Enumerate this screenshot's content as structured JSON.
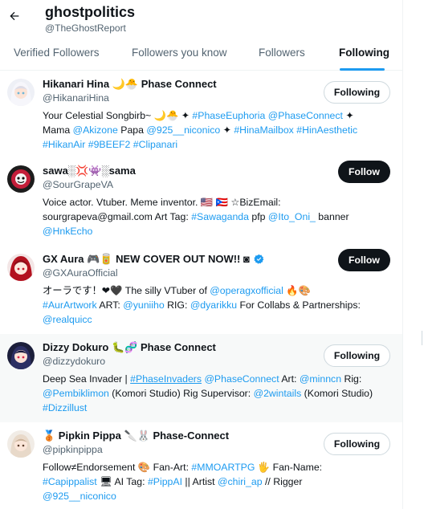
{
  "header": {
    "title": "ghostpolitics",
    "handle": "@TheGhostReport"
  },
  "tabs": [
    {
      "label": "Verified Followers"
    },
    {
      "label": "Followers you know"
    },
    {
      "label": "Followers"
    },
    {
      "label": "Following"
    }
  ],
  "active_tab": "Following",
  "users": [
    {
      "name": "Hikanari Hina",
      "name_suffix": " Phase Connect",
      "handle": "@HikanariHina",
      "button": "Following",
      "bio_lines": [
        [
          {
            "t": "Your Celestial Songbirb~ 🌙🐣 ✦ "
          },
          {
            "t": "#PhaseEuphoria",
            "k": "link"
          },
          {
            "t": " "
          },
          {
            "t": "@PhaseConnect",
            "k": "link"
          },
          {
            "t": " ✦"
          }
        ],
        [
          {
            "t": "Mama "
          },
          {
            "t": "@Akizone",
            "k": "link"
          },
          {
            "t": " Papa "
          },
          {
            "t": "@925__niconico",
            "k": "link"
          },
          {
            "t": " ✦ "
          },
          {
            "t": "#HinaMailbox",
            "k": "link"
          },
          {
            "t": " "
          },
          {
            "t": "#HinAesthetic",
            "k": "link"
          }
        ],
        [
          {
            "t": "#HikanAir",
            "k": "link"
          },
          {
            "t": " "
          },
          {
            "t": "#9BEEF2",
            "k": "link"
          },
          {
            "t": " "
          },
          {
            "t": "#Clipanari",
            "k": "link"
          }
        ]
      ]
    },
    {
      "name": "sawa░💢👾░sama",
      "name_suffix": "",
      "handle": "@SourGrapeVA",
      "button": "Follow",
      "bio_lines": [
        [
          {
            "t": "Voice actor. Vtuber. Meme inventor. 🇺🇸 🇵🇷 ☆BizEmail:"
          }
        ],
        [
          {
            "t": "sourgrapeva@gmail.com Art Tag: "
          },
          {
            "t": "#Sawaganda",
            "k": "link"
          },
          {
            "t": " pfp "
          },
          {
            "t": "@Ito_Oni_",
            "k": "link"
          },
          {
            "t": " banner"
          }
        ],
        [
          {
            "t": "@HnkEcho",
            "k": "link"
          }
        ]
      ]
    },
    {
      "name": "GX Aura 🎮🥫 NEW COVER OUT NOW!! ◙",
      "name_suffix": "",
      "handle": "@GXAuraOfficial",
      "button": "Follow",
      "verified": true,
      "bio_lines": [
        [
          {
            "t": "オーラです！❤🖤 The silly VTuber of "
          },
          {
            "t": "@operagxofficial",
            "k": "link"
          },
          {
            "t": " 🔥🎨"
          }
        ],
        [
          {
            "t": "#AurArtwork",
            "k": "link"
          },
          {
            "t": " ART: "
          },
          {
            "t": "@yuniiho",
            "k": "link"
          },
          {
            "t": " RIG: "
          },
          {
            "t": "@dyarikku",
            "k": "link"
          },
          {
            "t": " For Collabs & Partnerships:"
          }
        ],
        [
          {
            "t": "@realquicc",
            "k": "link"
          }
        ]
      ]
    },
    {
      "name": "Dizzy Dokuro",
      "name_suffix": " Phase Connect",
      "handle": "@dizzydokuro",
      "button": "Following",
      "bio_lines": [
        [
          {
            "t": "Deep Sea Invader | "
          },
          {
            "t": "#PhaseInvaders",
            "k": "under"
          },
          {
            "t": " "
          },
          {
            "t": "@PhaseConnect",
            "k": "link"
          },
          {
            "t": " Art: "
          },
          {
            "t": "@minncn",
            "k": "link"
          },
          {
            "t": " Rig:"
          }
        ],
        [
          {
            "t": "@Pembiklimon",
            "k": "link"
          },
          {
            "t": " (Komori Studio) Rig Supervisor: "
          },
          {
            "t": "@2wintails",
            "k": "link"
          },
          {
            "t": " (Komori Studio)"
          }
        ],
        [
          {
            "t": "#Dizzillust",
            "k": "link"
          }
        ]
      ]
    },
    {
      "name": "🥉 Pipkin Pippa",
      "name_suffix": " Phase-Connect",
      "handle": "@pipkinpippa",
      "button": "Following",
      "bio_lines": [
        [
          {
            "t": "Follow≠Endorsement 🎨 Fan-Art: "
          },
          {
            "t": "#MMOARTPG",
            "k": "link"
          },
          {
            "t": " 🖐 Fan-Name:"
          }
        ],
        [
          {
            "t": "#Capippalist",
            "k": "link"
          },
          {
            "t": " 🖥 AI Tag: "
          },
          {
            "t": "#PippAI",
            "k": "link"
          },
          {
            "t": " || Artist "
          },
          {
            "t": "@chiri_ap",
            "k": "link"
          },
          {
            "t": " // Rigger"
          }
        ],
        [
          {
            "t": "@925__niconico",
            "k": "link"
          }
        ]
      ]
    }
  ],
  "name_emojis": {
    "hina": "🌙🐣",
    "dizzy": "🐛🧬",
    "pippa": "🔪🐰"
  },
  "colors": {
    "accent": "#1d9bf0",
    "text": "#0f1419",
    "muted": "#536471",
    "hover_row": "#f7f9f9"
  },
  "icons": {
    "back": "arrow-left-icon",
    "verified": "verified-badge-icon"
  }
}
